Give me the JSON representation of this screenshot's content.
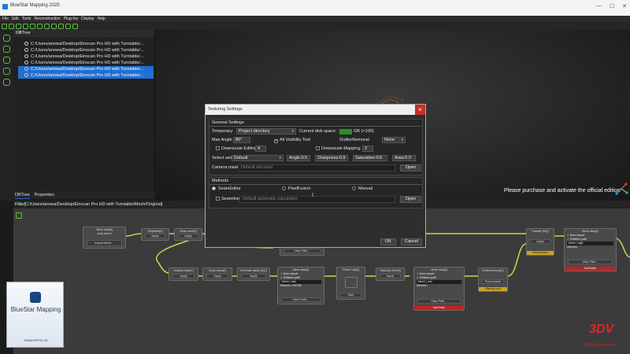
{
  "window": {
    "title": "BlueStar Mapping 2025"
  },
  "menu": [
    "File",
    "Edit",
    "Tools",
    "Reconstruction",
    "Plug-Ins",
    "Display",
    "Help"
  ],
  "dbtree": {
    "title": "DBTree",
    "rows": [
      {
        "label": "C:/Users/anowa/Desktop/Einscan Pro HD with Turntable/...",
        "selected": false
      },
      {
        "label": "C:/Users/anowa/Desktop/Einscan Pro HD with Turntable/...",
        "selected": false
      },
      {
        "label": "C:/Users/anowa/Desktop/Einscan Pro HD with Turntable/...",
        "selected": false
      },
      {
        "label": "C:/Users/anowa/Desktop/Einscan Pro HD with Turntable/...",
        "selected": false
      },
      {
        "label": "C:/Users/anowa/Desktop/Einscan Pro HD with Turntable/...",
        "selected": true
      },
      {
        "label": "C:/Users/anowa/Desktop/Einscan Pro HD with Turntable/...",
        "selected": true
      }
    ]
  },
  "bottom_tabs": [
    "DBTree",
    "Properties"
  ],
  "flow": {
    "title": "Flow[C:/Users/anowa/Desktop/Einscan Pro HD with Turntable/Mesh/Original]"
  },
  "watermark": "Please purchase and activate the official edition",
  "dialog": {
    "title": "Texturing Settings",
    "close": "×",
    "general": {
      "title": "General Settings",
      "temporary_label": "Temporary:",
      "temporary_value": "Project directory",
      "disk_label": "Current disk space:",
      "disk_value": "GB (>100)",
      "max_angle_label": "Max Angle",
      "max_angle_value": "80°",
      "all_visibility": "All Visibility Test",
      "outlier_label": "OutlierRemoval",
      "outlier_value": "None",
      "downscale_editing": "Downscale Editing",
      "downscale_editing_value": "4",
      "downscale_mapping": "Downscale Mapping",
      "downscale_mapping_value": "2",
      "weights_label": "Select weights",
      "weights_value": "Default",
      "angle": "Angle:0.5",
      "sharpness": "Sharpness:0.9",
      "saturation": "Saturation:0.6",
      "area": "Area:0.0",
      "camera_mask_label": "Camera mask",
      "camera_mask_placeholder": "Default not used",
      "open_label": "Open"
    },
    "methods": {
      "title": "Methods",
      "options": [
        "SeamEditor",
        "PixelFusion",
        "Manual"
      ],
      "seamline_label": "Seamline",
      "seamline_placeholder": "Default automatic calculation",
      "open_label": "Open"
    },
    "ok_label": "OK",
    "cancel_label": "Cancel"
  },
  "flow_nodes": {
    "mesh_data_a": {
      "title": "Mesh data[4]",
      "sub": "Auto import",
      "button": "Import Mesh..."
    },
    "simplified": {
      "title": "Simplified[1]",
      "button": "Apply"
    },
    "clean_mesh_a": {
      "title": "Clean mesh[*]",
      "button": "Apply"
    },
    "simplify_mesh": {
      "title": "Simplify mesh[*]",
      "button": "Apply"
    },
    "clean_mesh_b": {
      "title": "Clean mesh[*]",
      "button": "Apply"
    },
    "generate_mesh": {
      "title": "Generate mesh (M)[*]",
      "button": "Apply"
    },
    "view_path_top": "View Path...",
    "mesh_data_b": {
      "title": "Mesh data[4]",
      "auto": "Auto import",
      "rel": "Relative path",
      "mesh_label": "Mesh | mid",
      "meshes": "Meshes: 196786",
      "view": "View Path..."
    },
    "photo_cap": {
      "title": "Photo Cap[4]",
      "button": "Start"
    },
    "texturing": {
      "title": "Texturing mesh[*]",
      "button": "Apply"
    },
    "mesh_data_c": {
      "title": "Mesh data[4]",
      "auto": "Auto import",
      "rel": "Relative path",
      "mesh_label": "Mesh | mid",
      "meshes": "Meshes:",
      "view": "View Path...",
      "status": "Not Exists"
    },
    "reflow": {
      "title": "Reflow textures[*]",
      "button": "Precompute",
      "status": "Missing Input"
    },
    "transfer": {
      "title": "Transfer (M)[*]",
      "button": "Apply",
      "status": "Missing Input"
    },
    "mesh_data_d": {
      "title": "Mesh data[4]",
      "auto": "Auto import",
      "rel": "Relative path",
      "mesh_label": "Mesh | high",
      "meshes": "Meshes:",
      "view": "View Path...",
      "status": "Not Exists"
    }
  },
  "product_box": {
    "name": "BlueStar Mapping",
    "sub": "3DMAKERPRO 3D"
  },
  "brand": {
    "logo": "3DV",
    "sub": "Digital Fabrication"
  },
  "colors": {
    "accent": "#1f6fd4",
    "icon_green": "#59c43a",
    "warn_yellow": "#c9a227",
    "error_red": "#c41f1f",
    "close_red": "#c9302c"
  }
}
